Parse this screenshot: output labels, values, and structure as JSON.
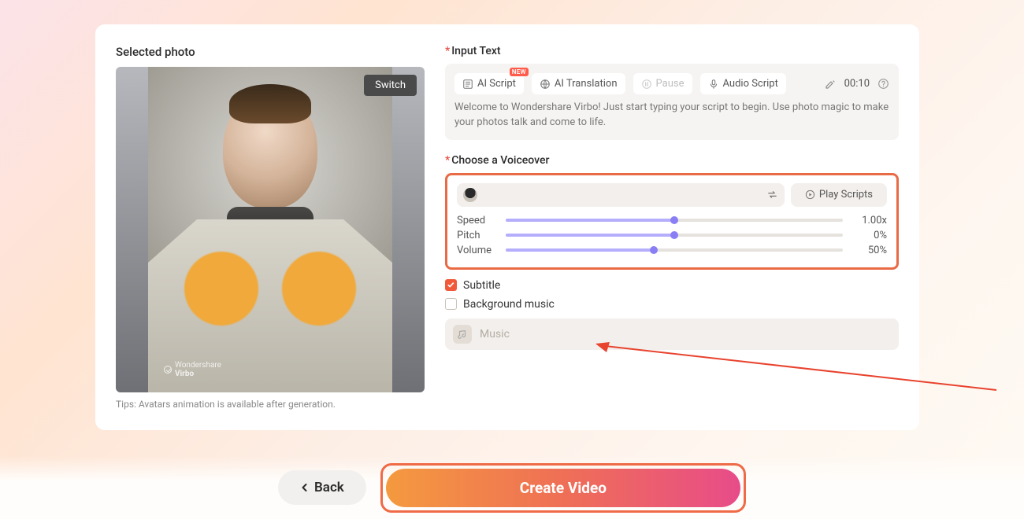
{
  "left": {
    "title": "Selected photo",
    "switch": "Switch",
    "watermark_brand": "Wondershare",
    "watermark_product": "Virbo",
    "tips": "Tips: Avatars animation is available after generation."
  },
  "input": {
    "label": "Input Text",
    "ai_script": "AI Script",
    "ai_script_badge": "NEW",
    "ai_translation": "AI Translation",
    "pause": "Pause",
    "audio_script": "Audio Script",
    "duration": "00:10",
    "script_text": "Welcome to Wondershare Virbo! Just start typing your script to begin. Use photo magic to make your photos talk and come to life."
  },
  "voiceover": {
    "label": "Choose a Voiceover",
    "play": "Play Scripts",
    "sliders": [
      {
        "label": "Speed",
        "value_text": "1.00x",
        "pct": 50
      },
      {
        "label": "Pitch",
        "value_text": "0%",
        "pct": 50
      },
      {
        "label": "Volume",
        "value_text": "50%",
        "pct": 44
      }
    ]
  },
  "options": {
    "subtitle": "Subtitle",
    "bgm": "Background music",
    "music_placeholder": "Music"
  },
  "footer": {
    "back": "Back",
    "create": "Create Video"
  }
}
